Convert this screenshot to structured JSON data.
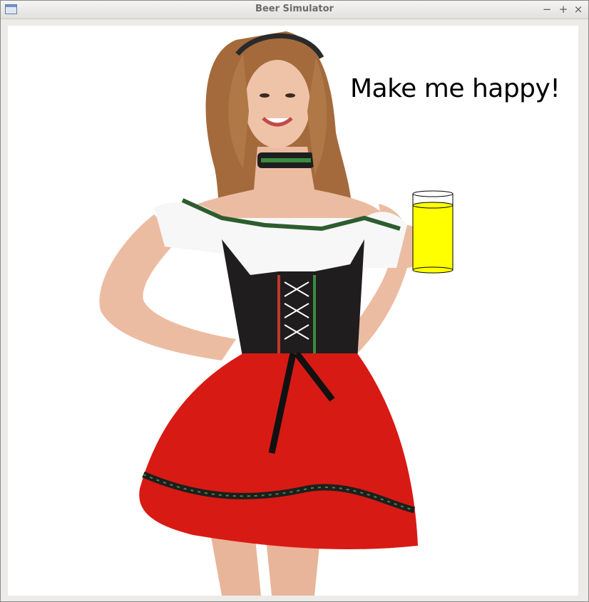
{
  "window": {
    "title": "Beer Simulator",
    "controls": {
      "minimize": "−",
      "maximize": "+",
      "close": "×"
    },
    "icon": "app-window-icon"
  },
  "scene": {
    "message": "Make me happy!",
    "figure": "woman-in-dirndl-photo",
    "beer_glass": {
      "fill_level": 0.85,
      "liquid_color": "#ffff00",
      "outline_color": "#000000"
    }
  },
  "colors": {
    "canvas_background": "#ffffff",
    "window_chrome": "#ecebe8",
    "dress_red": "#d81a14",
    "bodice_black": "#1f1d1d",
    "blouse_white": "#f7f7f7"
  }
}
